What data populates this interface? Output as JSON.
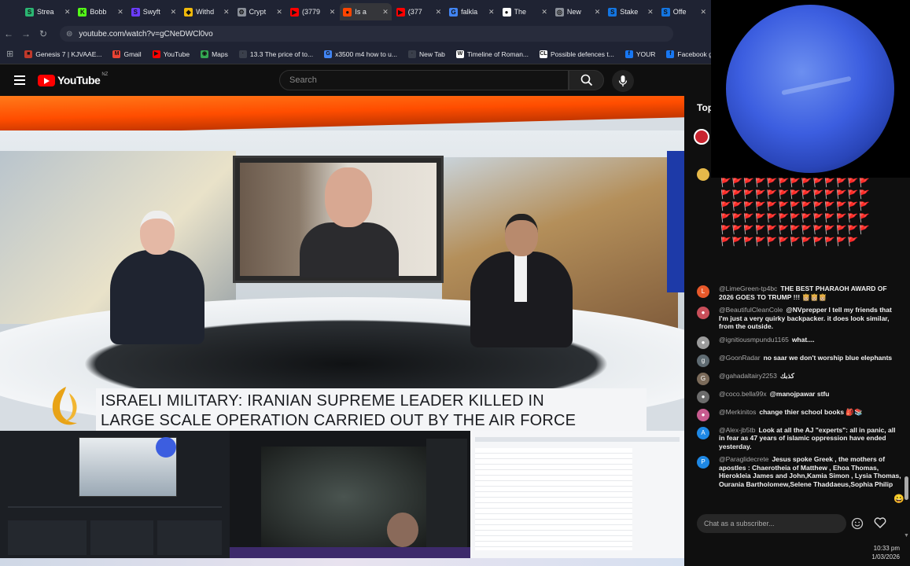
{
  "browser": {
    "tabs": [
      {
        "label": "Strea",
        "icon": "stream-icon",
        "color": "#2bb673",
        "glyph": "S"
      },
      {
        "label": "Bobb",
        "icon": "kick-icon",
        "color": "#53fc18",
        "glyph": "K"
      },
      {
        "label": "Swyft",
        "icon": "swyft-icon",
        "color": "#6b3cff",
        "glyph": "S"
      },
      {
        "label": "Withd",
        "icon": "binance-icon",
        "color": "#f0b90b",
        "glyph": "◆"
      },
      {
        "label": "Crypt",
        "icon": "gear-icon",
        "color": "#8a8f99",
        "glyph": "⚙"
      },
      {
        "label": "(3779",
        "icon": "youtube-icon",
        "color": "#ff0000",
        "glyph": "▶"
      },
      {
        "label": "Is a",
        "icon": "reddit-icon",
        "color": "#ff4500",
        "glyph": "●"
      },
      {
        "label": "(377",
        "icon": "youtube-icon",
        "color": "#ff0000",
        "glyph": "▶"
      },
      {
        "label": "falkla",
        "icon": "google-icon",
        "color": "#4285f4",
        "glyph": "G"
      },
      {
        "label": "The",
        "icon": "github-icon",
        "color": "#ffffff",
        "glyph": "●"
      },
      {
        "label": "New",
        "icon": "globe-icon",
        "color": "#8a8f99",
        "glyph": "◎"
      },
      {
        "label": "Stake",
        "icon": "stake-icon",
        "color": "#1475e1",
        "glyph": "S"
      },
      {
        "label": "Offe",
        "icon": "stake-icon",
        "color": "#1475e1",
        "glyph": "S"
      }
    ],
    "url": "youtube.com/watch?v=gCNeDWCl0vo",
    "bookmarks": [
      {
        "label": "Genesis 7 | KJVAAE...",
        "color": "#c0392b",
        "glyph": "■"
      },
      {
        "label": "Gmail",
        "color": "#ea4335",
        "glyph": "M"
      },
      {
        "label": "YouTube",
        "color": "#ff0000",
        "glyph": "▶"
      },
      {
        "label": "Maps",
        "color": "#34a853",
        "glyph": "◉"
      },
      {
        "label": "13.3 The price of to...",
        "color": "#3a3f4b",
        "glyph": "·"
      },
      {
        "label": "x3500 m4 how to u...",
        "color": "#4285f4",
        "glyph": "G"
      },
      {
        "label": "New Tab",
        "color": "#3a3f4b",
        "glyph": "·"
      },
      {
        "label": "Timeline of Roman...",
        "color": "#ffffff",
        "glyph": "W"
      },
      {
        "label": "Possible defences t...",
        "color": "#ffffff",
        "glyph": "CL"
      },
      {
        "label": "YOUR",
        "color": "#1877f2",
        "glyph": "f"
      },
      {
        "label": "Facebook green",
        "color": "#1877f2",
        "glyph": "f"
      }
    ]
  },
  "youtube": {
    "logo_text": "YouTube",
    "region": "NZ",
    "search_placeholder": "Search"
  },
  "video": {
    "headline_line1": "ISRAELI MILITARY: IRANIAN SUPREME LEADER KILLED IN",
    "headline_line2": "LARGE SCALE OPERATION CARRIED OUT BY THE AIR FORCE"
  },
  "chat": {
    "header": "Top",
    "flags": "🚩🚩🚩🚩🚩🚩🚩🚩🚩🚩🚩🚩🚩🚩🚩🚩🚩🚩🚩🚩🚩🚩🚩🚩🚩🚩🚩🚩🚩🚩🚩🚩🚩🚩🚩🚩🚩🚩🚩🚩🚩🚩🚩🚩🚩🚩🚩🚩🚩🚩🚩🚩🚩🚩🚩🚩🚩🚩🚩🚩🚩🚩🚩🚩🚩🚩🚩🚩🚩🚩🚩🚩🚩🚩🚩🚩🚩",
    "messages": [
      {
        "user": "@LimeGreen-tp4bc",
        "text": "THE BEST PHARAOH AWARD OF 2026 GOES TO TRUMP !!! 👸🏼👸🏼👸🏼",
        "avatar_color": "#e8592a",
        "initial": "L"
      },
      {
        "user": "@BeautifulCleanCole",
        "text": "@NVprepper I tell my friends that I'm just a very quirky backpacker. it does look similar, from the outside.",
        "avatar_color": "#c94f5a",
        "initial": "●"
      },
      {
        "user": "@ignitiousmpundu1165",
        "text": "what....",
        "avatar_color": "#9b9b9b",
        "initial": "●"
      },
      {
        "user": "@GoonRadar",
        "text": "no saar we don't worship blue elephants",
        "avatar_color": "#5f6b72",
        "initial": "g"
      },
      {
        "user": "@gahadaltairy2253",
        "text": "كذبك",
        "avatar_color": "#7b6b5a",
        "initial": "G"
      },
      {
        "user": "@coco.bella99x",
        "text": "@manojpawar stfu",
        "avatar_color": "#6c6c6c",
        "initial": "●"
      },
      {
        "user": "@Merkinitos",
        "text": "change thier school books 🎒📚",
        "avatar_color": "#c75b8f",
        "initial": "●"
      },
      {
        "user": "@Alex-jb5tb",
        "text": "Look at all the AJ \"experts\": all in panic, all in fear as 47 years of islamic oppression have ended yesterday.",
        "avatar_color": "#1e88e5",
        "initial": "A"
      },
      {
        "user": "@Paraglidecrete",
        "text": "Jesus spoke Greek , the mothers of apostles : Chaerotheia of Matthew , Ehoa Thomas, Hierokleia James and John,Kamia Simon , Lysia Thomas, Ourania Bartholomew,Selene Thaddaeus,Sophia Philip",
        "avatar_color": "#1e88e5",
        "initial": "P"
      }
    ],
    "input_placeholder": "Chat as a subscriber..."
  },
  "system": {
    "time": "10:33 pm",
    "date": "1/03/2026"
  }
}
